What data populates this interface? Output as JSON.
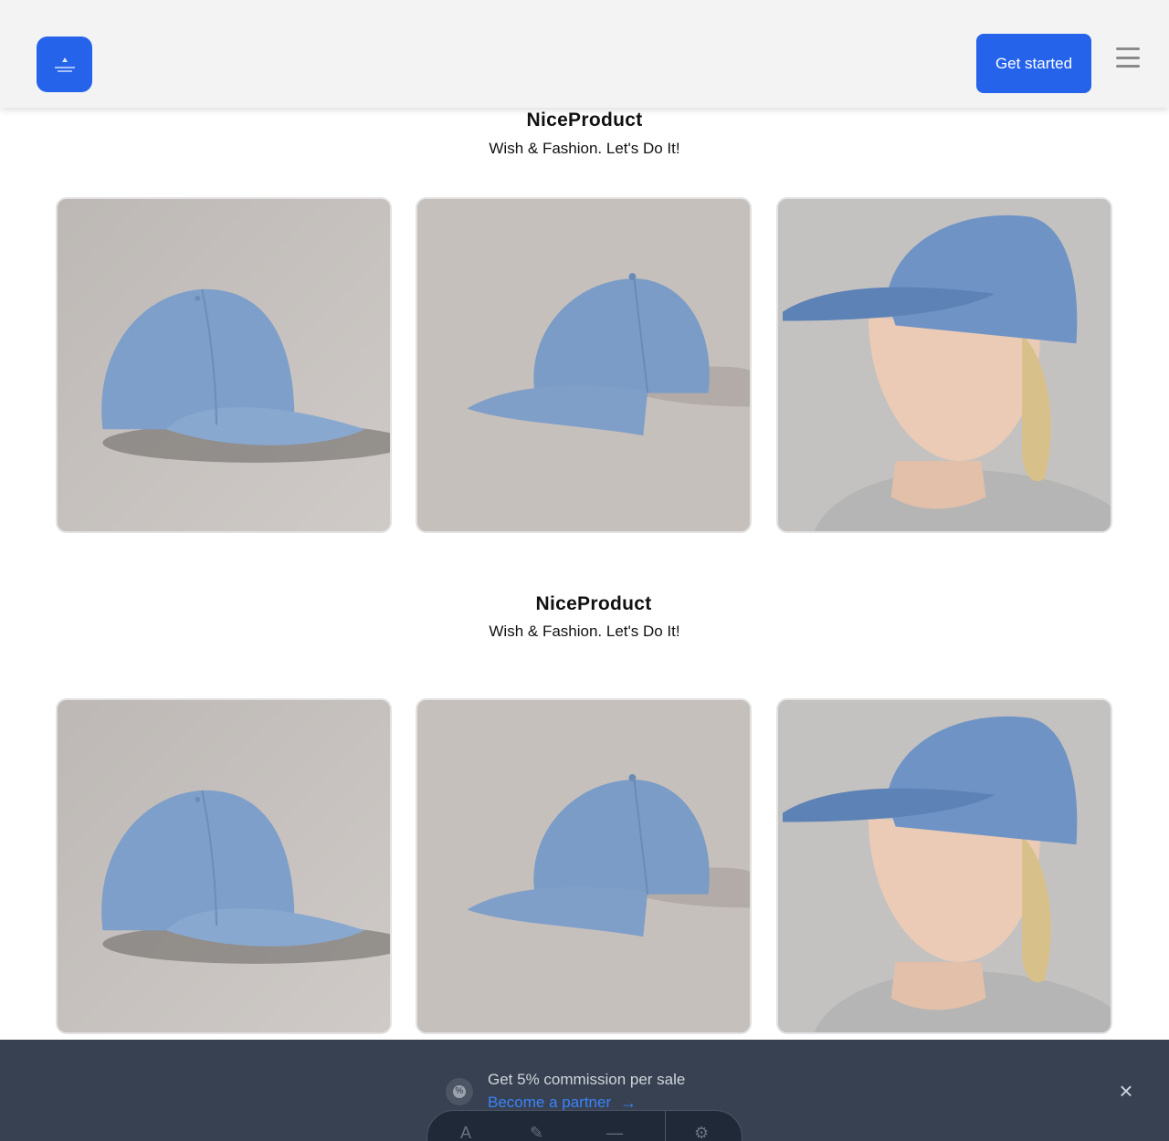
{
  "header": {
    "cta_label": "Get started"
  },
  "sections": [
    {
      "title": "NiceProduct",
      "subtitle": "Wish & Fashion. Let's Do It!"
    },
    {
      "title": "NiceProduct",
      "subtitle": "Wish & Fashion. Let's Do It!"
    }
  ],
  "banner": {
    "text": "Get 5% commission per sale",
    "link": "Become a partner"
  },
  "icons": {
    "logo": "logo-icon",
    "menu": "hamburger-menu-icon",
    "commission": "percent-badge-icon",
    "arrow": "arrow-right-icon",
    "close": "close-icon"
  },
  "colors": {
    "accent": "#2563eb",
    "banner_bg": "#374151",
    "link": "#3b82f6",
    "cap": "#7a9cc6"
  }
}
